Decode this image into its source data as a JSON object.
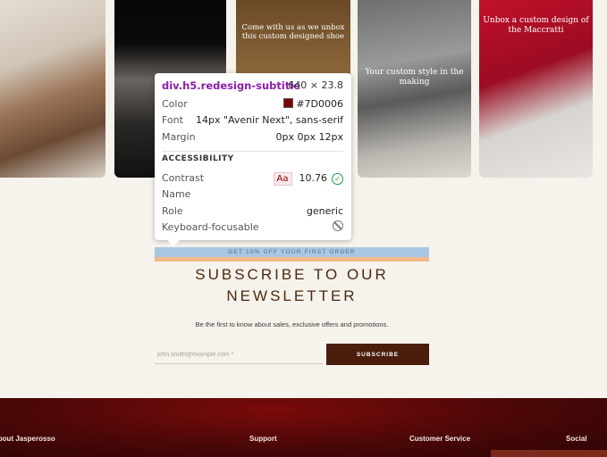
{
  "gallery": {
    "tiles": [
      {
        "caption": ""
      },
      {
        "caption": ""
      },
      {
        "caption": "Come with us as we unbox this custom designed shoe"
      },
      {
        "caption": "Your custom style in the making"
      },
      {
        "caption": "Unbox a custom design of the Maccratti"
      }
    ]
  },
  "newsletter": {
    "promo_banner": "GET 10% OFF YOUR FIRST ORDER",
    "title": "SUBSCRIBE TO OUR NEWSLETTER",
    "description": "Be the first to know about sales, exclusive offers and promotions.",
    "email_placeholder": "john.smith@example.com *",
    "subscribe_label": "SUBSCRIBE"
  },
  "footer": {
    "columns": [
      "About Jasperosso",
      "Support",
      "Customer Service",
      "Social"
    ]
  },
  "inspector": {
    "selector": "div.h5.redesign-subtitle",
    "dimensions": "640 × 23.8",
    "color_label": "Color",
    "color_value": "#7D0006",
    "font_label": "Font",
    "font_value": "14px \"Avenir Next\", sans-serif",
    "margin_label": "Margin",
    "margin_value": "0px 0px 12px",
    "section_title": "ACCESSIBILITY",
    "contrast_label": "Contrast",
    "contrast_badge": "Aa",
    "contrast_value": "10.76",
    "name_label": "Name",
    "role_label": "Role",
    "role_value": "generic",
    "keyboard_label": "Keyboard-focusable"
  },
  "colors": {
    "brand_dark": "#4a1d0c",
    "title_brown": "#4a2a10",
    "inspected_color": "#7D0006",
    "selector_purple": "#8b1fa9",
    "contrast_ok_green": "#1e9e44"
  }
}
